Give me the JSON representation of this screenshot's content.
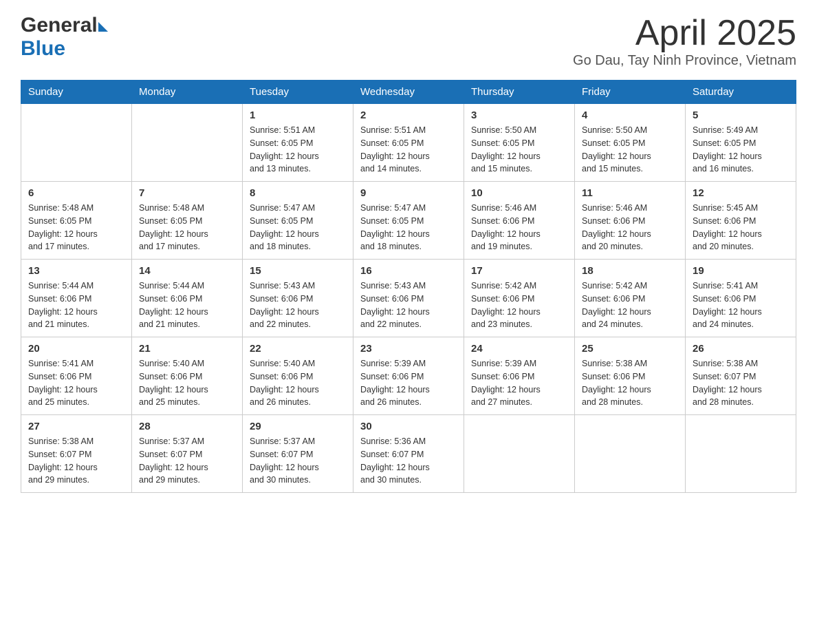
{
  "header": {
    "title": "April 2025",
    "location": "Go Dau, Tay Ninh Province, Vietnam",
    "logo_general": "General",
    "logo_blue": "Blue"
  },
  "calendar": {
    "days_of_week": [
      "Sunday",
      "Monday",
      "Tuesday",
      "Wednesday",
      "Thursday",
      "Friday",
      "Saturday"
    ],
    "weeks": [
      [
        {
          "day": "",
          "info": ""
        },
        {
          "day": "",
          "info": ""
        },
        {
          "day": "1",
          "info": "Sunrise: 5:51 AM\nSunset: 6:05 PM\nDaylight: 12 hours\nand 13 minutes."
        },
        {
          "day": "2",
          "info": "Sunrise: 5:51 AM\nSunset: 6:05 PM\nDaylight: 12 hours\nand 14 minutes."
        },
        {
          "day": "3",
          "info": "Sunrise: 5:50 AM\nSunset: 6:05 PM\nDaylight: 12 hours\nand 15 minutes."
        },
        {
          "day": "4",
          "info": "Sunrise: 5:50 AM\nSunset: 6:05 PM\nDaylight: 12 hours\nand 15 minutes."
        },
        {
          "day": "5",
          "info": "Sunrise: 5:49 AM\nSunset: 6:05 PM\nDaylight: 12 hours\nand 16 minutes."
        }
      ],
      [
        {
          "day": "6",
          "info": "Sunrise: 5:48 AM\nSunset: 6:05 PM\nDaylight: 12 hours\nand 17 minutes."
        },
        {
          "day": "7",
          "info": "Sunrise: 5:48 AM\nSunset: 6:05 PM\nDaylight: 12 hours\nand 17 minutes."
        },
        {
          "day": "8",
          "info": "Sunrise: 5:47 AM\nSunset: 6:05 PM\nDaylight: 12 hours\nand 18 minutes."
        },
        {
          "day": "9",
          "info": "Sunrise: 5:47 AM\nSunset: 6:05 PM\nDaylight: 12 hours\nand 18 minutes."
        },
        {
          "day": "10",
          "info": "Sunrise: 5:46 AM\nSunset: 6:06 PM\nDaylight: 12 hours\nand 19 minutes."
        },
        {
          "day": "11",
          "info": "Sunrise: 5:46 AM\nSunset: 6:06 PM\nDaylight: 12 hours\nand 20 minutes."
        },
        {
          "day": "12",
          "info": "Sunrise: 5:45 AM\nSunset: 6:06 PM\nDaylight: 12 hours\nand 20 minutes."
        }
      ],
      [
        {
          "day": "13",
          "info": "Sunrise: 5:44 AM\nSunset: 6:06 PM\nDaylight: 12 hours\nand 21 minutes."
        },
        {
          "day": "14",
          "info": "Sunrise: 5:44 AM\nSunset: 6:06 PM\nDaylight: 12 hours\nand 21 minutes."
        },
        {
          "day": "15",
          "info": "Sunrise: 5:43 AM\nSunset: 6:06 PM\nDaylight: 12 hours\nand 22 minutes."
        },
        {
          "day": "16",
          "info": "Sunrise: 5:43 AM\nSunset: 6:06 PM\nDaylight: 12 hours\nand 22 minutes."
        },
        {
          "day": "17",
          "info": "Sunrise: 5:42 AM\nSunset: 6:06 PM\nDaylight: 12 hours\nand 23 minutes."
        },
        {
          "day": "18",
          "info": "Sunrise: 5:42 AM\nSunset: 6:06 PM\nDaylight: 12 hours\nand 24 minutes."
        },
        {
          "day": "19",
          "info": "Sunrise: 5:41 AM\nSunset: 6:06 PM\nDaylight: 12 hours\nand 24 minutes."
        }
      ],
      [
        {
          "day": "20",
          "info": "Sunrise: 5:41 AM\nSunset: 6:06 PM\nDaylight: 12 hours\nand 25 minutes."
        },
        {
          "day": "21",
          "info": "Sunrise: 5:40 AM\nSunset: 6:06 PM\nDaylight: 12 hours\nand 25 minutes."
        },
        {
          "day": "22",
          "info": "Sunrise: 5:40 AM\nSunset: 6:06 PM\nDaylight: 12 hours\nand 26 minutes."
        },
        {
          "day": "23",
          "info": "Sunrise: 5:39 AM\nSunset: 6:06 PM\nDaylight: 12 hours\nand 26 minutes."
        },
        {
          "day": "24",
          "info": "Sunrise: 5:39 AM\nSunset: 6:06 PM\nDaylight: 12 hours\nand 27 minutes."
        },
        {
          "day": "25",
          "info": "Sunrise: 5:38 AM\nSunset: 6:06 PM\nDaylight: 12 hours\nand 28 minutes."
        },
        {
          "day": "26",
          "info": "Sunrise: 5:38 AM\nSunset: 6:07 PM\nDaylight: 12 hours\nand 28 minutes."
        }
      ],
      [
        {
          "day": "27",
          "info": "Sunrise: 5:38 AM\nSunset: 6:07 PM\nDaylight: 12 hours\nand 29 minutes."
        },
        {
          "day": "28",
          "info": "Sunrise: 5:37 AM\nSunset: 6:07 PM\nDaylight: 12 hours\nand 29 minutes."
        },
        {
          "day": "29",
          "info": "Sunrise: 5:37 AM\nSunset: 6:07 PM\nDaylight: 12 hours\nand 30 minutes."
        },
        {
          "day": "30",
          "info": "Sunrise: 5:36 AM\nSunset: 6:07 PM\nDaylight: 12 hours\nand 30 minutes."
        },
        {
          "day": "",
          "info": ""
        },
        {
          "day": "",
          "info": ""
        },
        {
          "day": "",
          "info": ""
        }
      ]
    ]
  }
}
